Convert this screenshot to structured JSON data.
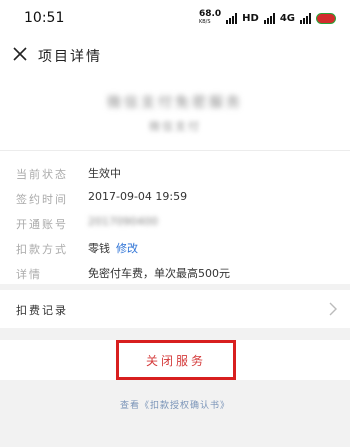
{
  "status_bar": {
    "time": "10:51",
    "net_speed": "68.0",
    "net_unit": "KB/S",
    "hd": "HD",
    "network": "4G"
  },
  "nav": {
    "title": "项目详情"
  },
  "header": {
    "service_name": "微信支付免密服务",
    "service_subtitle": "微信支付"
  },
  "details": {
    "rows": [
      {
        "label": "当前状态",
        "value": "生效中"
      },
      {
        "label": "签约时间",
        "value": "2017-09-04 19:59"
      },
      {
        "label": "开通账号",
        "value": "2017090400"
      },
      {
        "label": "扣款方式",
        "value": "零钱",
        "link": "修改"
      },
      {
        "label": "详情",
        "value": "免密付车费，单次最高500元"
      }
    ]
  },
  "records": {
    "label": "扣费记录"
  },
  "close_service": {
    "label": "关闭服务"
  },
  "footer": {
    "note": "查看《扣款授权确认书》"
  },
  "colors": {
    "accent_blue": "#2e73d6",
    "danger_red": "#d81f1f",
    "background": "#f2f2f2"
  }
}
